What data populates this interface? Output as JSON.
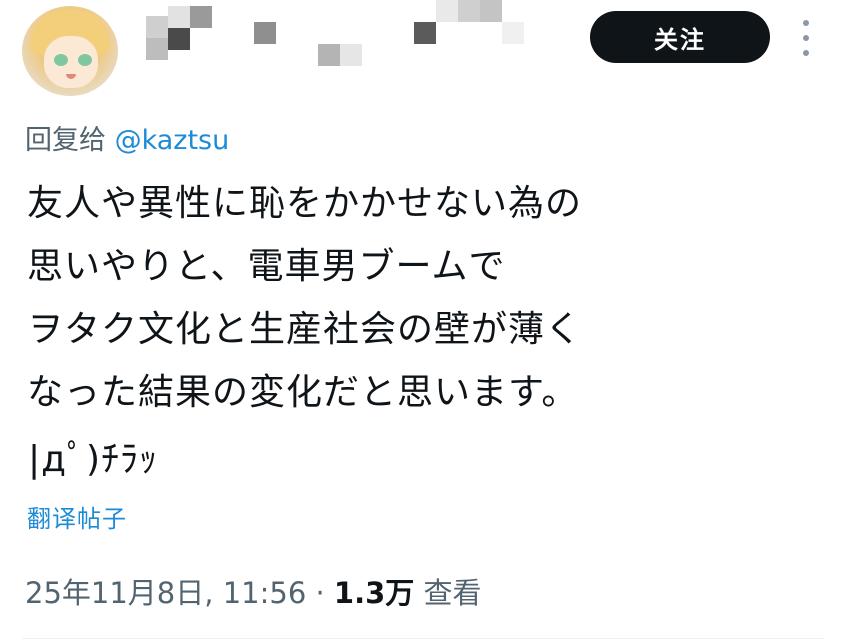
{
  "header": {
    "follow_label": "关注",
    "more_icon": "more-vertical-icon"
  },
  "reply": {
    "prefix": "回复给",
    "handle": "@kaztsu"
  },
  "tweet": {
    "lines": [
      "友人や異性に恥をかかせない為の",
      "思いやりと、電車男ブームで",
      "ヲタク文化と生産社会の壁が薄く",
      "なった結果の変化だと思います。"
    ],
    "kaomoji": "|дﾟ)ﾁﾗｯ"
  },
  "translate_label": "翻译帖子",
  "meta": {
    "datetime": "25年11月8日, 11:56",
    "separator": " · ",
    "views_count": "1.3万",
    "views_label": "查看"
  },
  "colors": {
    "text": "#0f1419",
    "secondary": "#536471",
    "link": "#1d8bd6",
    "button_bg": "#0f1419"
  }
}
